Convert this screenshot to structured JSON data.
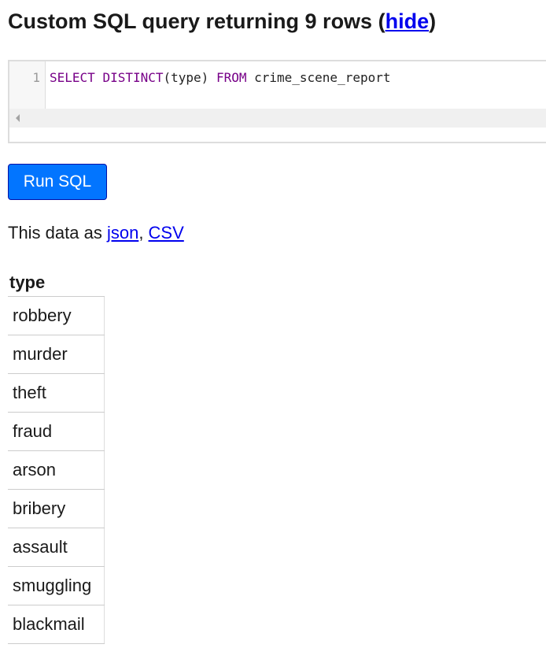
{
  "heading": {
    "prefix": "Custom SQL query returning 9 rows (",
    "hide_link": "hide",
    "suffix": ")"
  },
  "editor": {
    "line_number": "1",
    "tokens": [
      {
        "text": "SELECT",
        "kind": "keyword"
      },
      {
        "text": " ",
        "kind": "plain"
      },
      {
        "text": "DISTINCT",
        "kind": "keyword"
      },
      {
        "text": "(type) ",
        "kind": "plain"
      },
      {
        "text": "FROM",
        "kind": "keyword"
      },
      {
        "text": " crime_scene_report",
        "kind": "plain"
      }
    ]
  },
  "run_button_label": "Run SQL",
  "export": {
    "prefix": "This data as ",
    "json_link": "json",
    "separator": ", ",
    "csv_link": "CSV"
  },
  "table": {
    "column": "type",
    "rows": [
      "robbery",
      "murder",
      "theft",
      "fraud",
      "arson",
      "bribery",
      "assault",
      "smuggling",
      "blackmail"
    ]
  },
  "colors": {
    "accent": "#0275ff",
    "link": "#0000ee",
    "sql_keyword": "#770088"
  }
}
